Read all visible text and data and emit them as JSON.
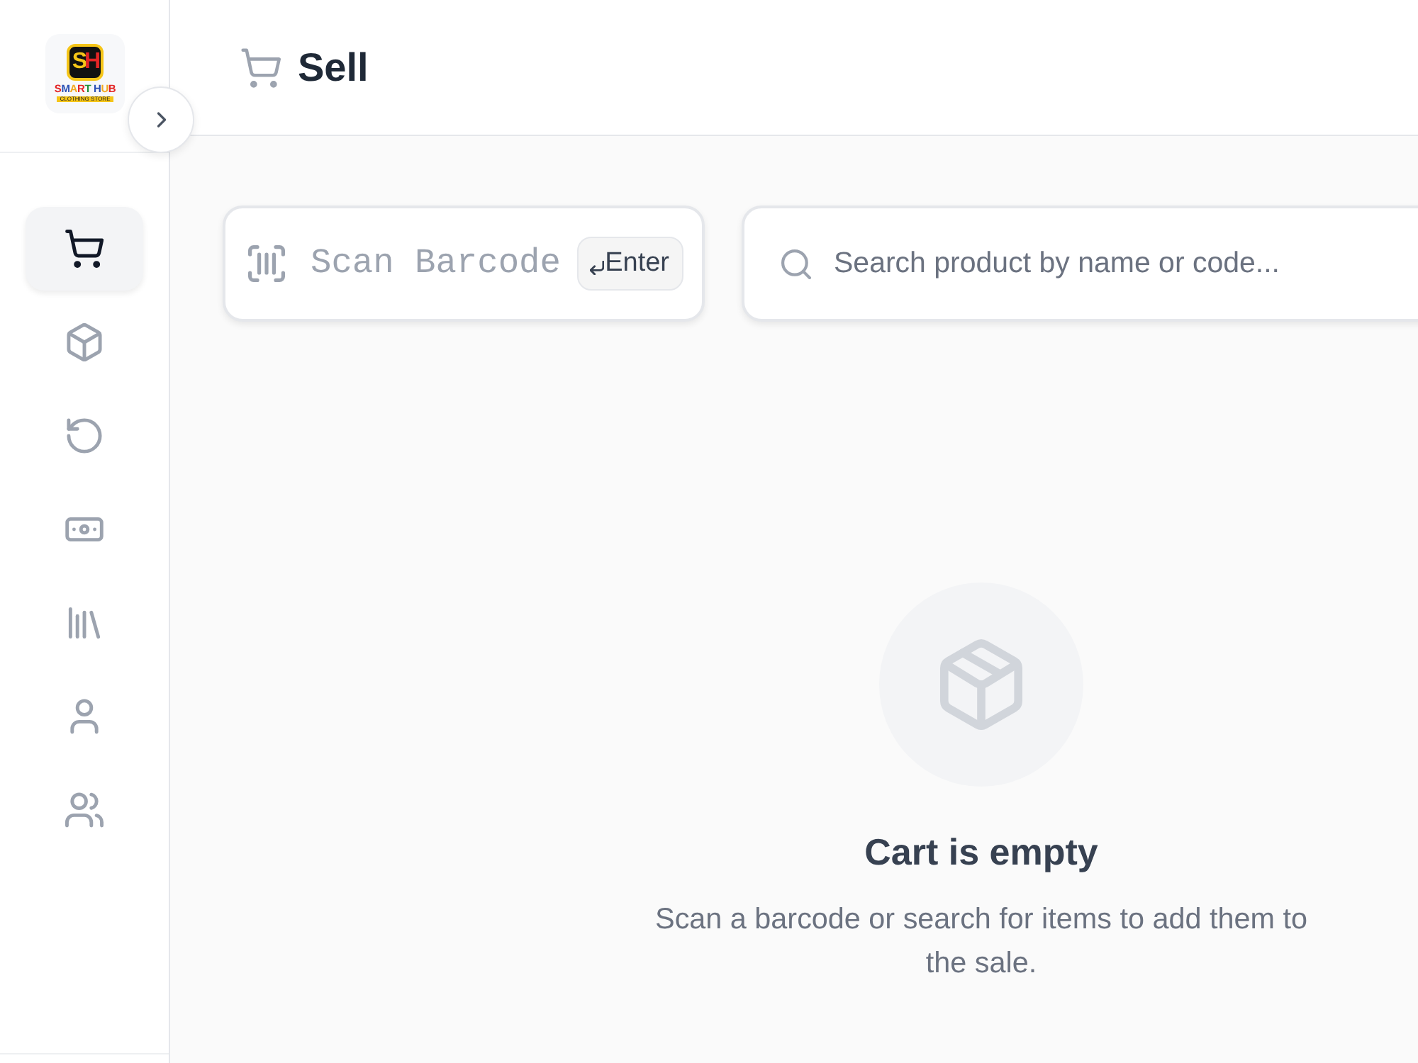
{
  "sidebar": {
    "logo": {
      "monogram": "SH",
      "name": "SMART HUB",
      "tagline": "CLOTHING STORE"
    },
    "items": [
      {
        "kind": "cart",
        "selected": true
      },
      {
        "kind": "box",
        "selected": false
      },
      {
        "kind": "undo",
        "selected": false
      },
      {
        "kind": "cash",
        "selected": false
      },
      {
        "kind": "library",
        "selected": false
      },
      {
        "kind": "user",
        "selected": false
      },
      {
        "kind": "users",
        "selected": false
      }
    ]
  },
  "header": {
    "title": "Sell"
  },
  "scanner": {
    "placeholder": "Scan Barcode",
    "key_hint": "Enter"
  },
  "search": {
    "placeholder": "Search product by name or code..."
  },
  "cart": {
    "empty_title": "Cart is empty",
    "empty_message": "Scan a barcode or search for items to add them to the sale."
  }
}
